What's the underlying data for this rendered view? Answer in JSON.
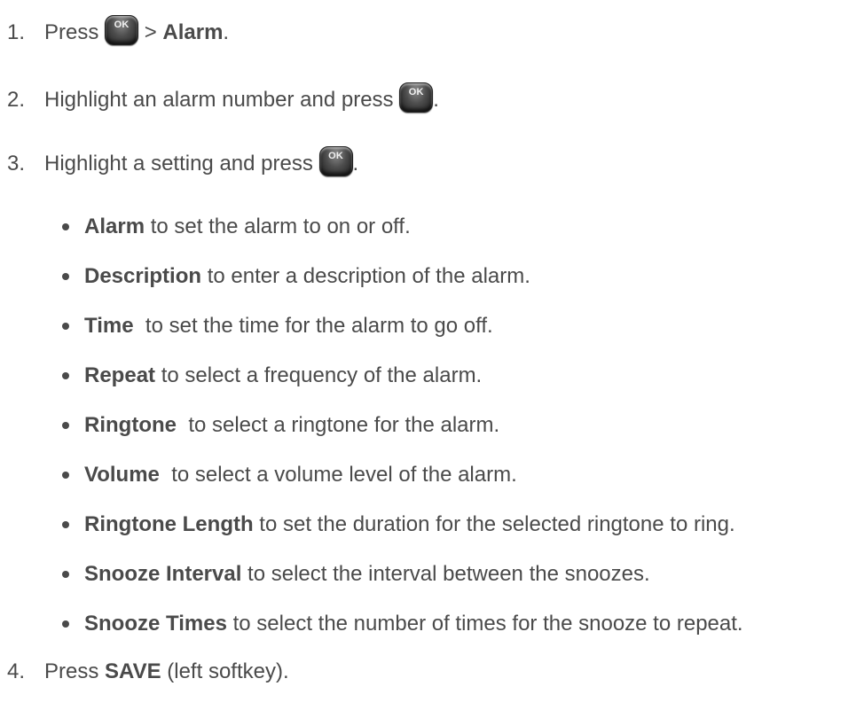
{
  "ok_key_label": "OK",
  "steps": [
    {
      "num": "1.",
      "pre": "Press",
      "mid": " > ",
      "bold": "Alarm",
      "post": "."
    },
    {
      "num": "2.",
      "pre": "Highlight an alarm number and press",
      "post": "."
    },
    {
      "num": "3.",
      "pre": "Highlight a setting and press",
      "post": "."
    },
    {
      "num": "4.",
      "pre": "Press ",
      "bold": "SAVE",
      "post": " (left softkey)."
    }
  ],
  "settings": [
    {
      "term": "Alarm",
      "desc": " to set the alarm to on or off."
    },
    {
      "term": "Description",
      "desc": " to enter a description of the alarm."
    },
    {
      "term": "Time",
      "desc": "  to set the time for the alarm to go off."
    },
    {
      "term": "Repeat",
      "desc": " to select a frequency of the alarm."
    },
    {
      "term": "Ringtone",
      "desc": "  to select a ringtone for the alarm."
    },
    {
      "term": "Volume",
      "desc": "  to select a volume level of the alarm."
    },
    {
      "term": "Ringtone Length",
      "desc": " to set the duration for the selected ringtone to ring."
    },
    {
      "term": "Snooze Interval",
      "desc": " to select the interval between the snoozes."
    },
    {
      "term": "Snooze Times",
      "desc": " to select the number of times for the snooze to repeat."
    }
  ]
}
